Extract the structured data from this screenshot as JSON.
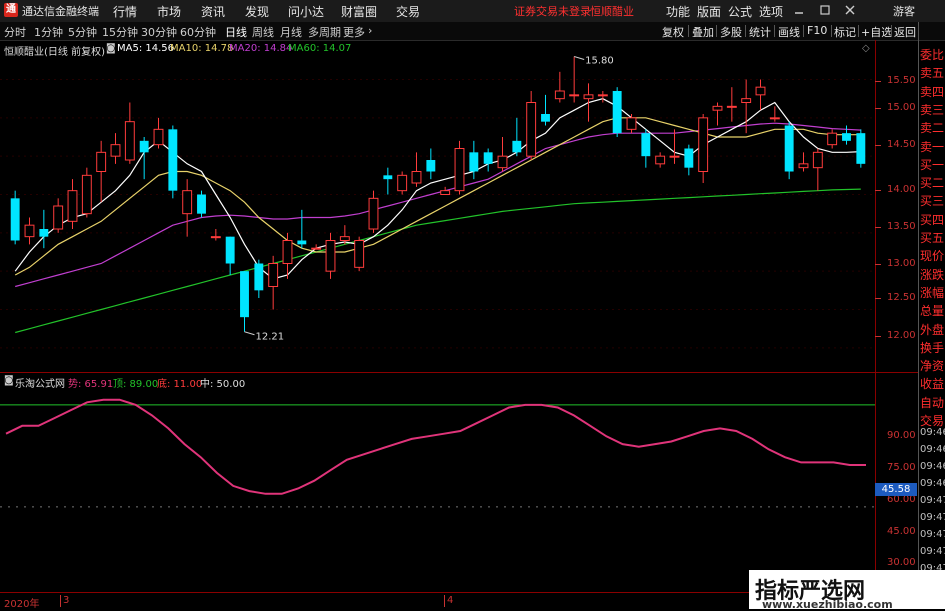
{
  "app": {
    "title": "通达信金融终端",
    "logo_text": "通"
  },
  "menu": [
    "行情",
    "市场",
    "资讯",
    "发现",
    "问小达",
    "财富圈",
    "交易"
  ],
  "warning": "证券交易未登录",
  "stock_name_top": "恒顺醋业",
  "right_menu": [
    "功能",
    "版面",
    "公式",
    "选项"
  ],
  "window_controls": [
    "minimize-icon",
    "restore-icon",
    "close-icon"
  ],
  "guest": "游客",
  "periods": [
    "分时",
    "1分钟",
    "5分钟",
    "15分钟",
    "30分钟",
    "60分钟",
    "日线",
    "周线",
    "月线",
    "多周期",
    "更多"
  ],
  "active_period": "日线",
  "right_tools": [
    "复权",
    "叠加",
    "多股",
    "统计",
    "画线",
    "F10",
    "标记",
    "+自选",
    "返回"
  ],
  "chart_header": {
    "name": "恒顺醋业(日线 前复权)",
    "ma5": "MA5: 14.56",
    "ma10": "MA10: 14.78",
    "ma20": "MA20: 14.84",
    "ma60": "MA60: 14.07"
  },
  "indicator_header": {
    "name": "乐淘公式网",
    "a": "势: 65.91",
    "b": "顶: 89.00",
    "c": "底: 11.00",
    "d": "中: 50.00"
  },
  "price_axis": [
    "15.50",
    "15.00",
    "14.50",
    "14.00",
    "13.50",
    "13.00",
    "12.50",
    "12.00"
  ],
  "indicator_axis": [
    "90.00",
    "75.00",
    "60.00",
    "45.00",
    "30.00"
  ],
  "indicator_badge": "45.58",
  "annot_high": "15.80",
  "annot_low": "12.21",
  "side_labels": [
    "委比",
    "卖五",
    "卖四",
    "卖三",
    "卖二",
    "卖一",
    "买一",
    "买二",
    "买三",
    "买四",
    "买五",
    "现价",
    "涨跌",
    "涨幅",
    "总量",
    "外盘",
    "换手",
    "净资",
    "收益",
    "自动",
    "交易"
  ],
  "time_labels": [
    "09:46",
    "09:46",
    "09:46",
    "09:46",
    "09:47",
    "09:47",
    "09:47",
    "09:47",
    "09:47"
  ],
  "date_labels": [
    "2020年",
    "3",
    "4"
  ],
  "watermark": {
    "line1": "指标严选网",
    "line2": "www.xuezhibiao.com"
  },
  "colors": {
    "up": "#ff3c3c",
    "down": "#00e5ff",
    "ma5": "#ffffff",
    "ma10": "#e8d26a",
    "ma20": "#c13fd0",
    "ma60": "#22c22a",
    "ind": "#e0347a",
    "grid": "#5a0000"
  },
  "chart_data": {
    "type": "candlestick",
    "candles": [
      [
        13.95,
        13.4,
        14.05,
        13.35
      ],
      [
        13.45,
        13.6,
        13.7,
        13.35
      ],
      [
        13.55,
        13.45,
        13.8,
        13.3
      ],
      [
        13.55,
        13.85,
        13.95,
        13.5
      ],
      [
        13.65,
        14.05,
        14.2,
        13.55
      ],
      [
        13.75,
        14.25,
        14.35,
        13.7
      ],
      [
        14.3,
        14.55,
        14.7,
        13.9
      ],
      [
        14.5,
        14.65,
        14.8,
        14.4
      ],
      [
        14.45,
        14.95,
        15.2,
        14.4
      ],
      [
        14.7,
        14.55,
        14.75,
        14.2
      ],
      [
        14.65,
        14.85,
        15.0,
        14.6
      ],
      [
        14.85,
        14.05,
        14.9,
        13.95
      ],
      [
        13.75,
        14.05,
        14.2,
        13.45
      ],
      [
        14.0,
        13.75,
        14.05,
        13.7
      ],
      [
        13.45,
        13.45,
        13.55,
        13.4
      ],
      [
        13.45,
        13.1,
        13.45,
        12.95
      ],
      [
        13.0,
        12.4,
        13.0,
        12.21
      ],
      [
        13.1,
        12.75,
        13.15,
        12.65
      ],
      [
        12.8,
        13.1,
        13.2,
        12.5
      ],
      [
        13.1,
        13.4,
        13.5,
        12.9
      ],
      [
        13.4,
        13.35,
        13.8,
        13.3
      ],
      [
        13.3,
        13.3,
        13.35,
        13.3
      ],
      [
        13.0,
        13.4,
        13.5,
        12.9
      ],
      [
        13.4,
        13.45,
        13.6,
        13.35
      ],
      [
        13.05,
        13.4,
        13.45,
        13.0
      ],
      [
        13.55,
        13.95,
        14.05,
        13.5
      ],
      [
        14.25,
        14.2,
        14.35,
        14.0
      ],
      [
        14.05,
        14.25,
        14.3,
        14.0
      ],
      [
        14.15,
        14.3,
        14.55,
        14.1
      ],
      [
        14.45,
        14.3,
        14.6,
        14.2
      ],
      [
        14.0,
        14.05,
        14.1,
        14.0
      ],
      [
        14.05,
        14.6,
        14.7,
        14.0
      ],
      [
        14.55,
        14.3,
        14.7,
        14.2
      ],
      [
        14.55,
        14.4,
        14.6,
        14.3
      ],
      [
        14.35,
        14.5,
        14.75,
        14.3
      ],
      [
        14.7,
        14.55,
        15.0,
        14.5
      ],
      [
        14.5,
        15.2,
        15.35,
        14.45
      ],
      [
        15.05,
        14.95,
        15.3,
        14.9
      ],
      [
        15.25,
        15.35,
        15.6,
        15.2
      ],
      [
        15.3,
        15.3,
        15.8,
        15.2
      ],
      [
        15.25,
        15.3,
        15.45,
        14.95
      ],
      [
        15.3,
        15.3,
        15.35,
        15.2
      ],
      [
        15.35,
        14.8,
        15.4,
        14.75
      ],
      [
        14.85,
        15.0,
        15.05,
        14.8
      ],
      [
        14.8,
        14.5,
        14.85,
        14.35
      ],
      [
        14.4,
        14.5,
        14.55,
        14.35
      ],
      [
        14.5,
        14.5,
        14.85,
        14.4
      ],
      [
        14.6,
        14.35,
        14.65,
        14.25
      ],
      [
        14.3,
        15.0,
        15.05,
        14.15
      ],
      [
        15.1,
        15.15,
        15.2,
        14.9
      ],
      [
        15.15,
        15.15,
        15.4,
        14.95
      ],
      [
        15.2,
        15.25,
        15.5,
        14.8
      ],
      [
        15.3,
        15.4,
        15.5,
        15.1
      ],
      [
        15.0,
        15.0,
        15.15,
        14.95
      ],
      [
        14.9,
        14.3,
        14.95,
        14.2
      ],
      [
        14.35,
        14.4,
        14.55,
        14.3
      ],
      [
        14.35,
        14.55,
        14.6,
        14.05
      ],
      [
        14.65,
        14.8,
        14.85,
        14.6
      ],
      [
        14.8,
        14.7,
        14.9,
        14.65
      ],
      [
        14.8,
        14.4,
        14.85,
        14.35
      ]
    ],
    "ma5": [
      13.0,
      13.25,
      13.45,
      13.6,
      13.7,
      13.75,
      13.9,
      14.05,
      14.25,
      14.55,
      14.7,
      14.55,
      14.4,
      14.3,
      14.0,
      13.7,
      13.35,
      13.05,
      12.9,
      12.95,
      13.15,
      13.3,
      13.35,
      13.38,
      13.35,
      13.45,
      13.6,
      13.8,
      14.05,
      14.15,
      14.2,
      14.25,
      14.3,
      14.4,
      14.45,
      14.55,
      14.7,
      14.8,
      15.0,
      15.1,
      15.2,
      15.25,
      15.15,
      15.0,
      14.85,
      14.7,
      14.55,
      14.5,
      14.65,
      14.75,
      14.85,
      14.95,
      15.1,
      15.2,
      14.95,
      14.75,
      14.6,
      14.55,
      14.55,
      14.56
    ],
    "ma10": [
      12.95,
      13.05,
      13.2,
      13.35,
      13.45,
      13.55,
      13.65,
      13.8,
      13.95,
      14.1,
      14.25,
      14.3,
      14.3,
      14.25,
      14.15,
      14.05,
      13.9,
      13.7,
      13.55,
      13.4,
      13.3,
      13.25,
      13.25,
      13.25,
      13.3,
      13.35,
      13.45,
      13.55,
      13.65,
      13.75,
      13.85,
      13.95,
      14.05,
      14.15,
      14.25,
      14.35,
      14.45,
      14.55,
      14.65,
      14.75,
      14.85,
      14.95,
      15.0,
      15.0,
      15.0,
      14.95,
      14.9,
      14.85,
      14.8,
      14.75,
      14.75,
      14.75,
      14.8,
      14.85,
      14.85,
      14.85,
      14.8,
      14.78,
      14.78,
      14.78
    ],
    "ma20": [
      12.8,
      12.85,
      12.9,
      12.95,
      13.0,
      13.05,
      13.1,
      13.2,
      13.3,
      13.4,
      13.5,
      13.6,
      13.65,
      13.7,
      13.72,
      13.73,
      13.72,
      13.7,
      13.68,
      13.68,
      13.7,
      13.7,
      13.7,
      13.72,
      13.75,
      13.8,
      13.85,
      13.9,
      13.95,
      14.0,
      14.05,
      14.1,
      14.15,
      14.2,
      14.3,
      14.4,
      14.5,
      14.6,
      14.65,
      14.7,
      14.75,
      14.78,
      14.8,
      14.8,
      14.8,
      14.8,
      14.8,
      14.82,
      14.84,
      14.86,
      14.88,
      14.9,
      14.92,
      14.93,
      14.92,
      14.9,
      14.88,
      14.86,
      14.85,
      14.84
    ],
    "ma60": [
      12.2,
      12.25,
      12.3,
      12.35,
      12.4,
      12.45,
      12.5,
      12.55,
      12.6,
      12.65,
      12.7,
      12.75,
      12.8,
      12.85,
      12.9,
      12.95,
      13.0,
      13.05,
      13.1,
      13.15,
      13.2,
      13.25,
      13.3,
      13.35,
      13.4,
      13.45,
      13.5,
      13.55,
      13.6,
      13.63,
      13.66,
      13.69,
      13.72,
      13.75,
      13.78,
      13.8,
      13.82,
      13.84,
      13.86,
      13.88,
      13.89,
      13.9,
      13.91,
      13.92,
      13.93,
      13.94,
      13.95,
      13.96,
      13.97,
      13.98,
      13.99,
      14.0,
      14.01,
      14.02,
      14.03,
      14.04,
      14.05,
      14.06,
      14.065,
      14.07
    ],
    "indicator": [
      78,
      81,
      81,
      84,
      87,
      90,
      91,
      91,
      89,
      85,
      80,
      74,
      69,
      63,
      58,
      56,
      55,
      55,
      57,
      60,
      64,
      68,
      70,
      72,
      74,
      76,
      77,
      78,
      79,
      82,
      85,
      88,
      89,
      89,
      88,
      85,
      81,
      77,
      74,
      73,
      74,
      75,
      77,
      79,
      80,
      79,
      76,
      72,
      69,
      67,
      67,
      67,
      66,
      66
    ],
    "ylim": [
      11.75,
      15.95
    ],
    "ind_ylim": [
      22,
      97
    ]
  }
}
